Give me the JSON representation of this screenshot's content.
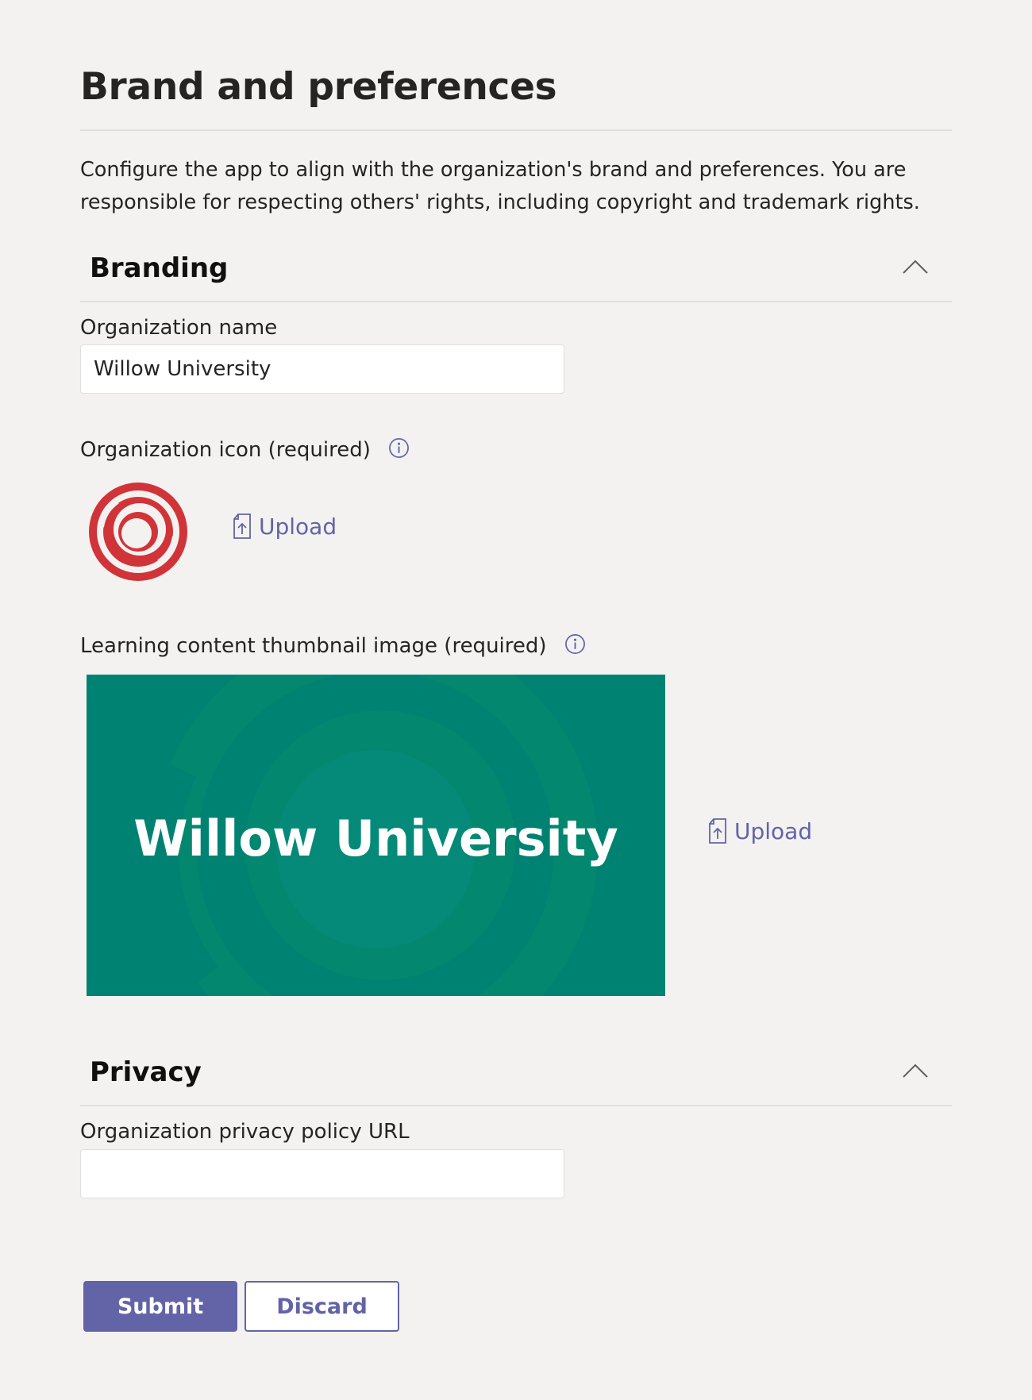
{
  "page": {
    "title": "Brand and preferences",
    "description": "Configure the app to align with the organization's brand and preferences. You are responsible for respecting others' rights, including copyright and trademark rights."
  },
  "branding": {
    "title": "Branding",
    "chevron_icon": "chevron-up-icon",
    "org_name": {
      "label": "Organization name",
      "value": "Willow University"
    },
    "org_icon": {
      "label": "Organization icon (required)",
      "info_icon": "info-icon",
      "logo_icon": "concentric-swirl-logo",
      "upload_label": "Upload",
      "upload_icon": "file-upload-icon"
    },
    "thumbnail": {
      "label": "Learning content thumbnail image (required)",
      "info_icon": "info-icon",
      "image_text": "Willow University",
      "upload_label": "Upload",
      "upload_icon": "file-upload-icon"
    }
  },
  "privacy": {
    "title": "Privacy",
    "chevron_icon": "chevron-up-icon",
    "policy_url": {
      "label": "Organization privacy policy URL",
      "value": ""
    }
  },
  "actions": {
    "submit_label": "Submit",
    "discard_label": "Discard"
  },
  "colors": {
    "accent": "#6264a7",
    "logo_red": "#d13438",
    "thumbnail_teal": "#008272",
    "background": "#f3f2f1"
  }
}
